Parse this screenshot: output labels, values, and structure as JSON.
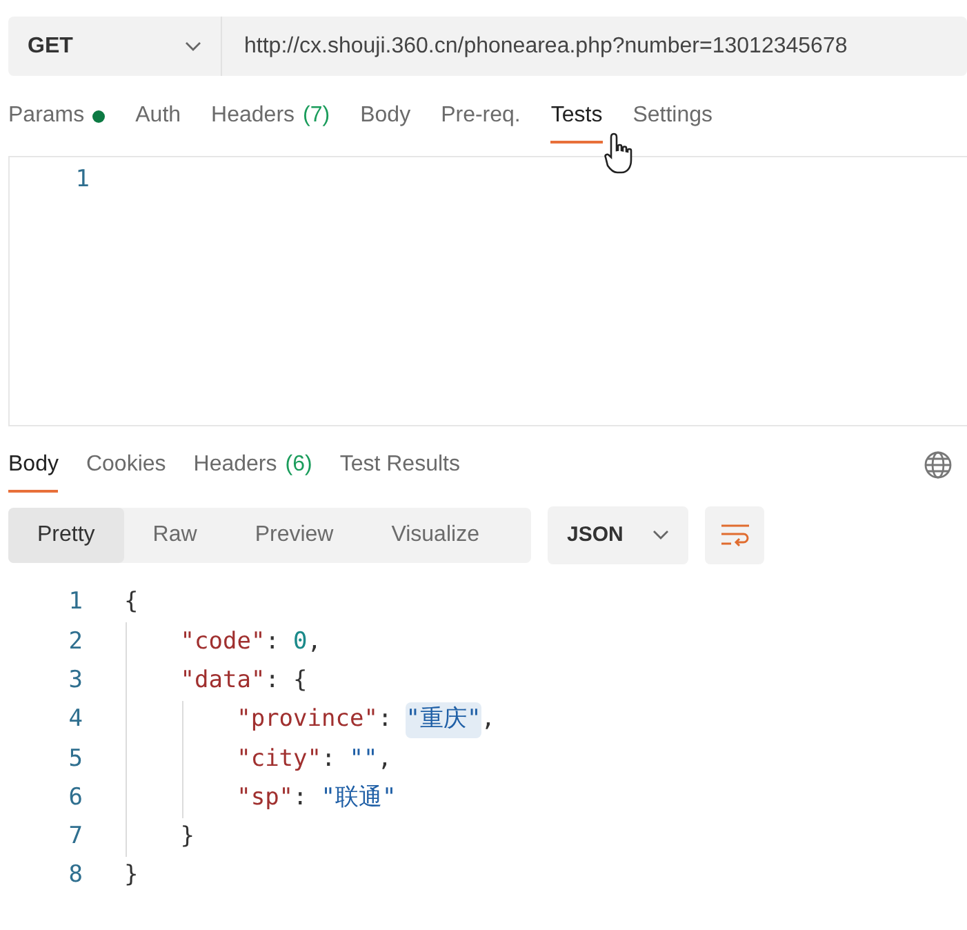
{
  "request": {
    "method": "GET",
    "url": "http://cx.shouji.360.cn/phonearea.php?number=13012345678"
  },
  "request_tabs": [
    {
      "label": "Params",
      "dot": true,
      "selected": false
    },
    {
      "label": "Auth",
      "selected": false
    },
    {
      "label": "Headers",
      "count": "(7)",
      "selected": false
    },
    {
      "label": "Body",
      "selected": false
    },
    {
      "label": "Pre-req.",
      "selected": false
    },
    {
      "label": "Tests",
      "selected": true
    },
    {
      "label": "Settings",
      "selected": false
    }
  ],
  "tests_editor": {
    "line_numbers": [
      "1"
    ]
  },
  "response_tabs": [
    {
      "label": "Body",
      "selected": true
    },
    {
      "label": "Cookies",
      "selected": false
    },
    {
      "label": "Headers",
      "count": "(6)",
      "selected": false
    },
    {
      "label": "Test Results",
      "selected": false
    }
  ],
  "view_modes": [
    {
      "label": "Pretty",
      "selected": true
    },
    {
      "label": "Raw",
      "selected": false
    },
    {
      "label": "Preview",
      "selected": false
    },
    {
      "label": "Visualize",
      "selected": false
    }
  ],
  "format": "JSON",
  "response_body": [
    {
      "number": "1",
      "tokens": [
        {
          "kind": "punct",
          "text": "{"
        }
      ],
      "children": [
        {
          "number": "2",
          "tokens": [
            {
              "kind": "key",
              "text": "\"code\""
            },
            {
              "kind": "punct",
              "text": ":"
            },
            {
              "kind": "number",
              "text": "0"
            },
            {
              "kind": "punct",
              "text": ","
            }
          ]
        },
        {
          "number": "3",
          "tokens": [
            {
              "kind": "key",
              "text": "\"data\""
            },
            {
              "kind": "punct",
              "text": ":"
            },
            {
              "kind": "punct",
              "text": "{"
            }
          ],
          "children": [
            {
              "number": "4",
              "tokens": [
                {
                  "kind": "key",
                  "text": "\"province\""
                },
                {
                  "kind": "punct",
                  "text": ":"
                },
                {
                  "kind": "string",
                  "text": "\"重庆\"",
                  "highlighted": true
                },
                {
                  "kind": "punct",
                  "text": ","
                }
              ]
            },
            {
              "number": "5",
              "tokens": [
                {
                  "kind": "key",
                  "text": "\"city\""
                },
                {
                  "kind": "punct",
                  "text": ":"
                },
                {
                  "kind": "string",
                  "text": "\"\"",
                  "highlighted": false
                },
                {
                  "kind": "punct",
                  "text": ","
                }
              ]
            },
            {
              "number": "6",
              "tokens": [
                {
                  "kind": "key",
                  "text": "\"sp\""
                },
                {
                  "kind": "punct",
                  "text": ":"
                },
                {
                  "kind": "string",
                  "text": "\"联通\"",
                  "highlighted": false
                }
              ]
            }
          ]
        },
        {
          "number": "7",
          "tokens": [
            {
              "kind": "punct",
              "text": "}"
            }
          ]
        }
      ]
    },
    {
      "number": "8",
      "tokens": [
        {
          "kind": "punct",
          "text": "}"
        }
      ]
    }
  ]
}
